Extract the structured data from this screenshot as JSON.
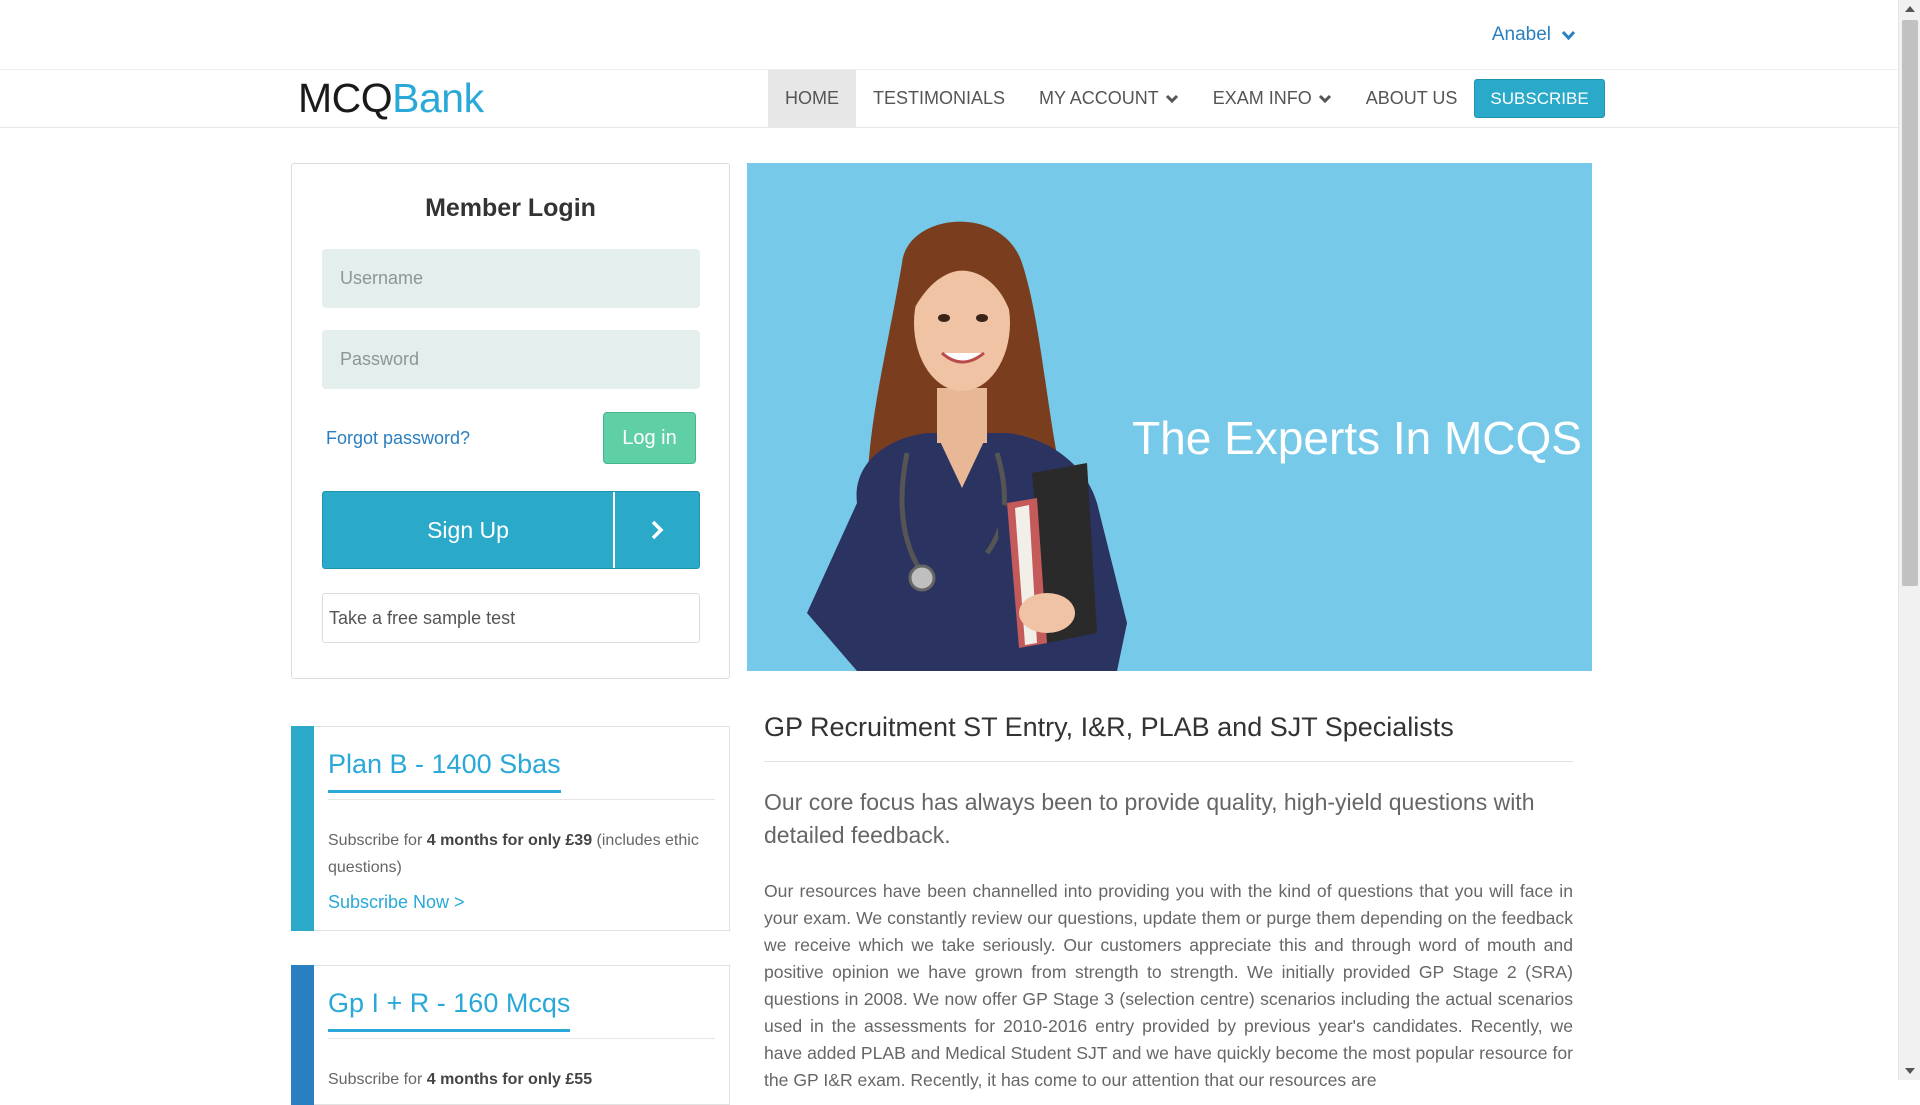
{
  "user_menu": {
    "name": "Anabel",
    "icon": "chevron-down-icon"
  },
  "brand": {
    "part1": "MCQ",
    "part2": "Bank"
  },
  "nav": {
    "home": "HOME",
    "testimonials": "TESTIMONIALS",
    "my_account": "MY ACCOUNT",
    "exam_info": "EXAM INFO",
    "about_us": "ABOUT US",
    "subscribe": "SUBSCRIBE"
  },
  "login": {
    "title": "Member Login",
    "username_placeholder": "Username",
    "password_placeholder": "Password",
    "username_value": "",
    "password_value": "",
    "forgot": "Forgot password?",
    "login_button": "Log in",
    "signup_button": "Sign Up",
    "sample_test": "Take a free sample test"
  },
  "hero": {
    "title": "The Experts In MCQS"
  },
  "plans": [
    {
      "title": "Plan B - 1400 Sbas",
      "desc_prefix": "Subscribe for ",
      "desc_bold": "4 months for only £39",
      "desc_suffix": " (includes ethic questions)",
      "link": "Subscribe Now >"
    },
    {
      "title": "Gp I + R - 160 Mcqs",
      "desc_prefix": "Subscribe for ",
      "desc_bold": "4 months for only £55",
      "desc_suffix": ""
    }
  ],
  "main": {
    "heading": "GP Recruitment ST Entry, I&R, PLAB and SJT Specialists",
    "lead": "Our core focus has always been to provide quality, high-yield questions with detailed feedback.",
    "body": "Our resources have been channelled into providing you with the kind of questions that you will face in your exam. We constantly review our questions, update them or purge them depending on the feedback we receive which we take seriously. Our customers appreciate this and through word of mouth and positive opinion we have grown from strength to strength. We initially provided GP Stage 2 (SRA) questions in 2008. We now offer GP Stage 3 (selection centre) scenarios including the actual scenarios used in the assessments for 2010-2016 entry provided by previous year's candidates. Recently, we have added PLAB and Medical Student SJT and we have quickly become the most popular resource for the GP I&R exam. Recently, it has come to our attention that our resources are"
  },
  "colors": {
    "accent": "#2aaac8",
    "link": "#2a7fc0",
    "hero_bg": "#76c9e8",
    "login_button": "#5fcfa6",
    "field_bg": "#e4eeec"
  }
}
